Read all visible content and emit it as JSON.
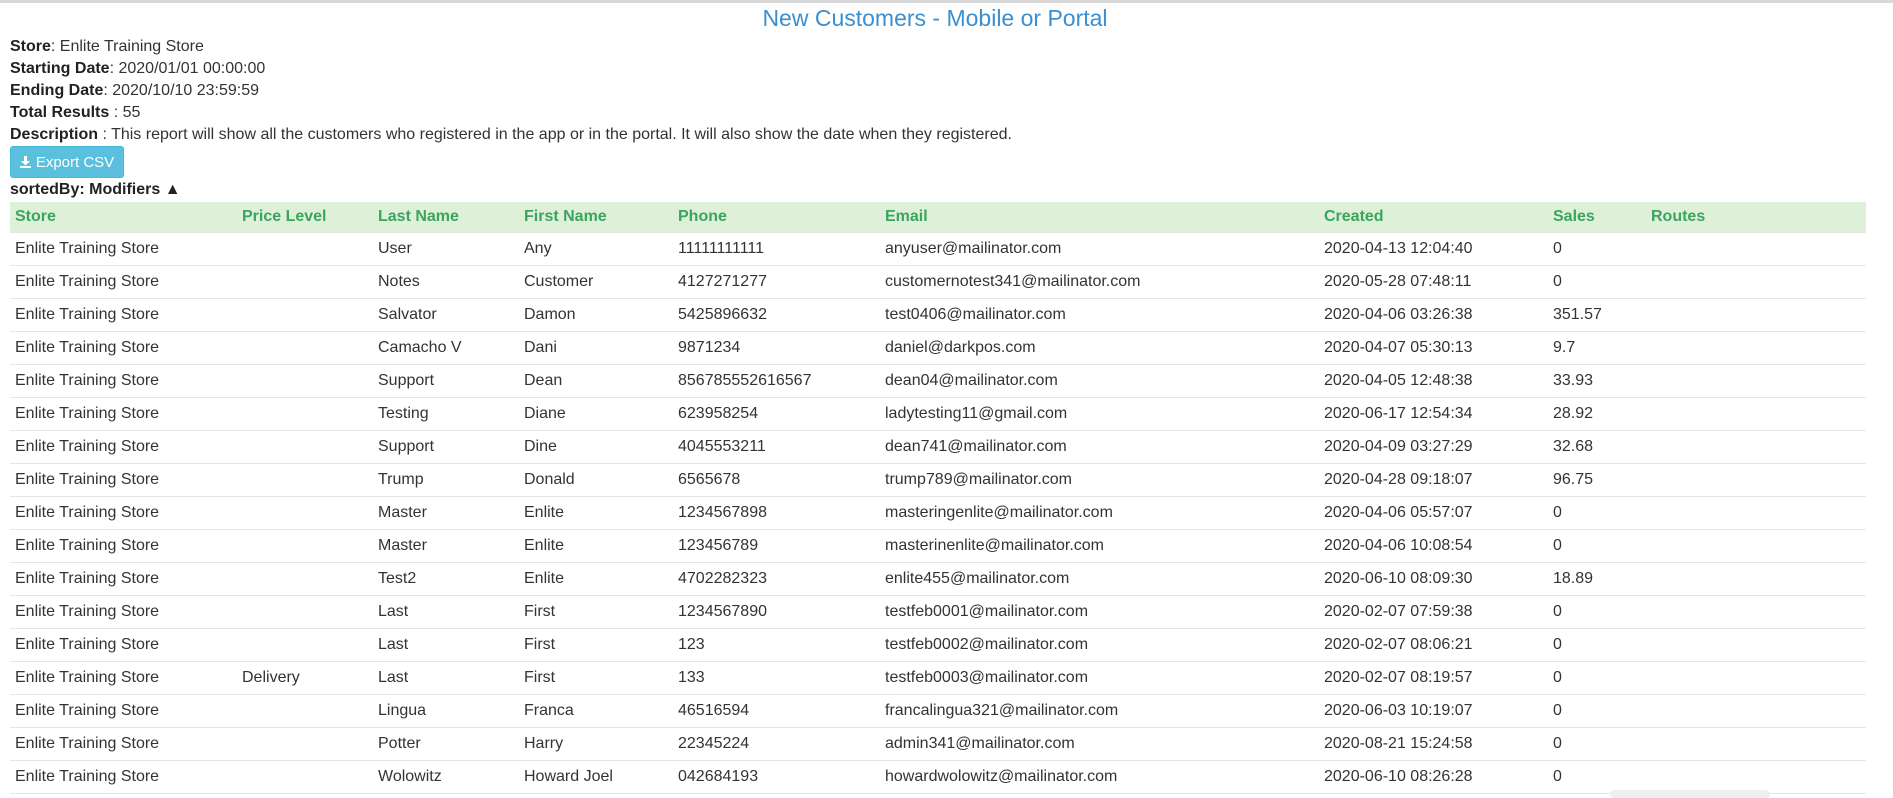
{
  "report": {
    "title": "New Customers - Mobile or Portal",
    "store_label": "Store",
    "store_value": ": Enlite Training Store",
    "start_label": "Starting Date",
    "start_value": ": 2020/01/01 00:00:00",
    "end_label": "Ending Date",
    "end_value": ": 2020/10/10 23:59:59",
    "total_label": "Total Results",
    "total_value": " : 55",
    "desc_label": "Description",
    "desc_value": " : This report will show all the customers who registered in the app or in the portal. It will also show the date when they registered.",
    "export_label": "Export CSV",
    "export_icon": "download-icon",
    "sorted_by": "sortedBy: Modifiers ▲"
  },
  "colors": {
    "title": "#3a8fd0",
    "header_bg": "#dff0d8",
    "header_text": "#3aa55e",
    "button": "#5bc0de"
  },
  "table": {
    "headers": [
      "Store",
      "Price Level",
      "Last Name",
      "First Name",
      "Phone",
      "Email",
      "Created",
      "Sales",
      "Routes"
    ],
    "rows": [
      [
        "Enlite Training Store",
        "",
        "User",
        "Any",
        "11111111111",
        "anyuser@mailinator.com",
        "2020-04-13 12:04:40",
        "0",
        ""
      ],
      [
        "Enlite Training Store",
        "",
        "Notes",
        "Customer",
        "4127271277",
        "customernotest341@mailinator.com",
        "2020-05-28 07:48:11",
        "0",
        ""
      ],
      [
        "Enlite Training Store",
        "",
        "Salvator",
        "Damon",
        "5425896632",
        "test0406@mailinator.com",
        "2020-04-06 03:26:38",
        "351.57",
        ""
      ],
      [
        "Enlite Training Store",
        "",
        "Camacho V",
        "Dani",
        "9871234",
        "daniel@darkpos.com",
        "2020-04-07 05:30:13",
        "9.7",
        ""
      ],
      [
        "Enlite Training Store",
        "",
        "Support",
        "Dean",
        "856785552616567",
        "dean04@mailinator.com",
        "2020-04-05 12:48:38",
        "33.93",
        ""
      ],
      [
        "Enlite Training Store",
        "",
        "Testing",
        "Diane",
        "623958254",
        "ladytesting11@gmail.com",
        "2020-06-17 12:54:34",
        "28.92",
        ""
      ],
      [
        "Enlite Training Store",
        "",
        "Support",
        "Dine",
        "4045553211",
        "dean741@mailinator.com",
        "2020-04-09 03:27:29",
        "32.68",
        ""
      ],
      [
        "Enlite Training Store",
        "",
        "Trump",
        "Donald",
        "6565678",
        "trump789@mailinator.com",
        "2020-04-28 09:18:07",
        "96.75",
        ""
      ],
      [
        "Enlite Training Store",
        "",
        "Master",
        "Enlite",
        "1234567898",
        "masteringenlite@mailinator.com",
        "2020-04-06 05:57:07",
        "0",
        ""
      ],
      [
        "Enlite Training Store",
        "",
        "Master",
        "Enlite",
        "123456789",
        "masterinenlite@mailinator.com",
        "2020-04-06 10:08:54",
        "0",
        ""
      ],
      [
        "Enlite Training Store",
        "",
        "Test2",
        "Enlite",
        "4702282323",
        "enlite455@mailinator.com",
        "2020-06-10 08:09:30",
        "18.89",
        ""
      ],
      [
        "Enlite Training Store",
        "",
        "Last",
        "First",
        "1234567890",
        "testfeb0001@mailinator.com",
        "2020-02-07 07:59:38",
        "0",
        ""
      ],
      [
        "Enlite Training Store",
        "",
        "Last",
        "First",
        "123",
        "testfeb0002@mailinator.com",
        "2020-02-07 08:06:21",
        "0",
        ""
      ],
      [
        "Enlite Training Store",
        "Delivery",
        "Last",
        "First",
        "133",
        "testfeb0003@mailinator.com",
        "2020-02-07 08:19:57",
        "0",
        ""
      ],
      [
        "Enlite Training Store",
        "",
        "Lingua",
        "Franca",
        "46516594",
        "francalingua321@mailinator.com",
        "2020-06-03 10:19:07",
        "0",
        ""
      ],
      [
        "Enlite Training Store",
        "",
        "Potter",
        "Harry",
        "22345224",
        "admin341@mailinator.com",
        "2020-08-21 15:24:58",
        "0",
        ""
      ],
      [
        "Enlite Training Store",
        "",
        "Wolowitz",
        "Howard Joel",
        "042684193",
        "howardwolowitz@mailinator.com",
        "2020-06-10 08:26:28",
        "0",
        ""
      ]
    ]
  }
}
